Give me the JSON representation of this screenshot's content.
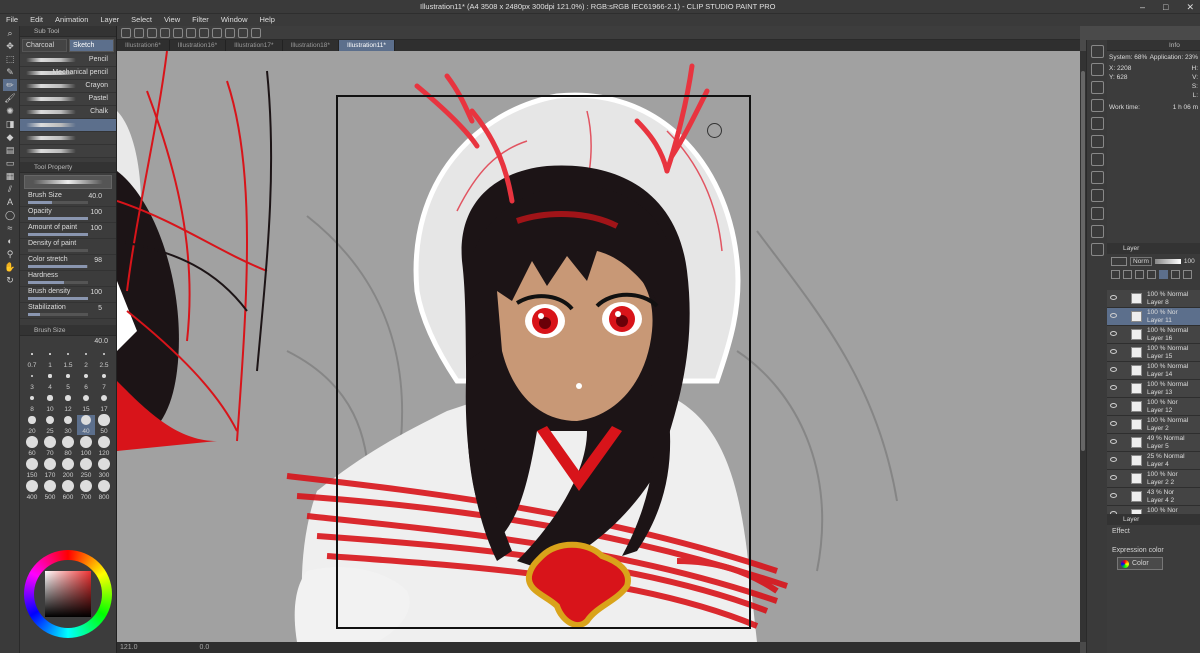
{
  "app": {
    "title": "Illustration11* (A4 3508 x 2480px 300dpi 121.0%) : RGB:sRGB IEC61966-2.1) - CLIP STUDIO PAINT PRO",
    "menu": [
      "File",
      "Edit",
      "Animation",
      "Layer",
      "Select",
      "View",
      "Filter",
      "Window",
      "Help"
    ]
  },
  "tabs": [
    "Illustration6*",
    "Illustration16*",
    "Illustration17*",
    "Illustration18*",
    "Illustration11*"
  ],
  "sub_tool": {
    "header": "Sub Tool",
    "tabs": [
      "Charcoal",
      "Sketch"
    ],
    "active_tab": "Sketch",
    "brushes": [
      "Pencil",
      "Mechanical pencil",
      "Crayon",
      "Pastel",
      "Chalk",
      "",
      "",
      ""
    ]
  },
  "tool_property": {
    "header": "Tool Property",
    "props": [
      {
        "label": "Brush Size",
        "value": "40.0",
        "fill": 0.4
      },
      {
        "label": "Opacity",
        "value": "100",
        "fill": 1
      },
      {
        "label": "Amount of paint",
        "value": "100",
        "fill": 1
      },
      {
        "label": "Density of paint",
        "value": "",
        "fill": 0
      },
      {
        "label": "Color stretch",
        "value": "98",
        "fill": 0.98
      },
      {
        "label": "Hardness",
        "value": "",
        "fill": 0.6
      },
      {
        "label": "Brush density",
        "value": "100",
        "fill": 1
      },
      {
        "label": "Stabilization",
        "value": "5",
        "fill": 0.2
      }
    ]
  },
  "brush_size": {
    "header": "Brush Size",
    "current": "40.0",
    "sizes": [
      "0.7",
      "1",
      "1.5",
      "2",
      "2.5",
      "3",
      "4",
      "5",
      "6",
      "7",
      "8",
      "10",
      "12",
      "15",
      "17",
      "20",
      "25",
      "30",
      "40",
      "50",
      "60",
      "70",
      "80",
      "100",
      "120",
      "150",
      "170",
      "200",
      "250",
      "300",
      "400",
      "500",
      "600",
      "700",
      "800"
    ],
    "selected": "40"
  },
  "status": {
    "zoom": "121.0",
    "angle": "0.0"
  },
  "info": {
    "header": "Info",
    "system": "System: 68%",
    "application": "Application: 23%",
    "x": "X: 2208",
    "y": "Y: 628",
    "h": "H:",
    "v": "V:",
    "s": "S:",
    "l": "L:",
    "work_time_label": "Work time:",
    "work_time": "1 h 06 m"
  },
  "layer_panel": {
    "header": "Layer",
    "blend": "Norm",
    "opacity": "100",
    "layers": [
      {
        "mode": "100 % Normal",
        "name": "Layer 8",
        "selected": false
      },
      {
        "mode": "100 % Nor",
        "name": "Layer 11",
        "selected": true
      },
      {
        "mode": "100 % Normal",
        "name": "Layer 16",
        "selected": false
      },
      {
        "mode": "100 % Normal",
        "name": "Layer 15",
        "selected": false
      },
      {
        "mode": "100 % Normal",
        "name": "Layer 14",
        "selected": false
      },
      {
        "mode": "100 % Normal",
        "name": "Layer 13",
        "selected": false
      },
      {
        "mode": "100 % Nor",
        "name": "Layer 12",
        "selected": false
      },
      {
        "mode": "100 % Normal",
        "name": "Layer 2",
        "selected": false
      },
      {
        "mode": "49 % Normal",
        "name": "Layer 5",
        "selected": false
      },
      {
        "mode": "25 % Normal",
        "name": "Layer 4",
        "selected": false
      },
      {
        "mode": "100 % Nor",
        "name": "Layer 2 2",
        "selected": false
      },
      {
        "mode": "43 % Nor",
        "name": "Layer 4 2",
        "selected": false
      },
      {
        "mode": "100 % Nor",
        "name": "",
        "selected": false
      }
    ]
  },
  "effect": {
    "header": "Layer",
    "effect_label": "Effect",
    "expression_color_label": "Expression color",
    "expression_color": "Color"
  },
  "colors": {
    "accent": "#5c6f8c",
    "canvas": "#a1a1a1",
    "red": "#d8141a",
    "hair": "#1c1416"
  }
}
